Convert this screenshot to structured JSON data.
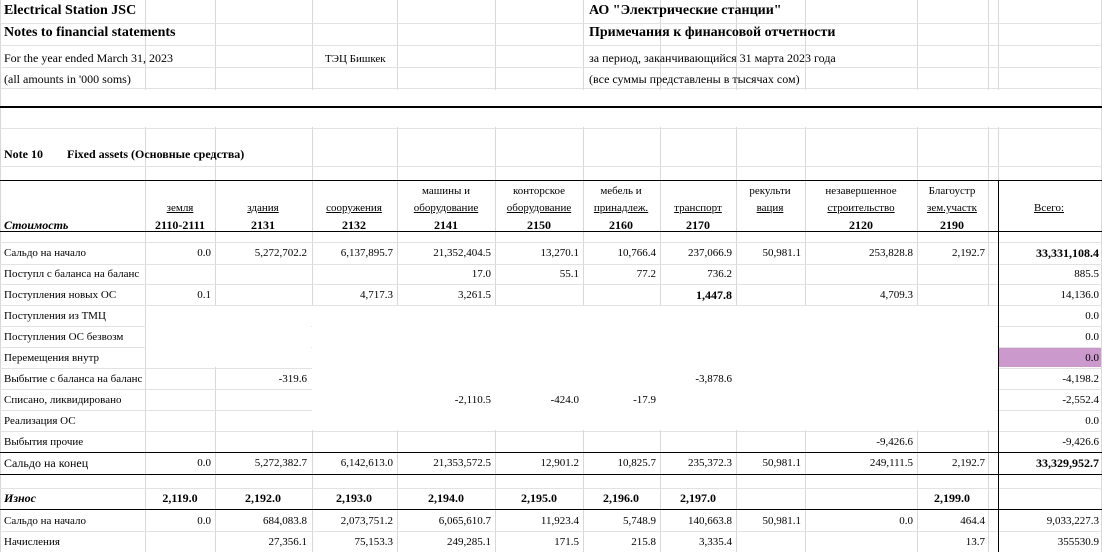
{
  "header": {
    "company_en": "Electrical Station JSC",
    "notes_en": "Notes to financial statements",
    "period_en": "For the year ended March 31, 2023",
    "amounts_en": "(all amounts in '000 soms)",
    "plant": "ТЭЦ Бишкек",
    "company_ru": "АО \"Электрические станции\"",
    "notes_ru": "Примечания к финансовой отчетности",
    "period_ru": "за период, заканчивающийся  31 марта 2023 года",
    "amounts_ru": "(все суммы представлены в тысячах сом)"
  },
  "note": {
    "number": "Note 10",
    "title": "Fixed assets (Основные средства)"
  },
  "columns": [
    {
      "line1": "",
      "line2": "земля",
      "code": "2110-2111"
    },
    {
      "line1": "",
      "line2": "здания",
      "code": "2131"
    },
    {
      "line1": "",
      "line2": "сооружения",
      "code": "2132"
    },
    {
      "line1": "машины и",
      "line2": "оборудование",
      "code": "2141"
    },
    {
      "line1": "конторское",
      "line2": "оборудование",
      "code": "2150"
    },
    {
      "line1": "мебель и",
      "line2": "принадлеж.",
      "code": "2160"
    },
    {
      "line1": "",
      "line2": "транспорт",
      "code": "2170"
    },
    {
      "line1": "рекульти",
      "line2": "вация",
      "code": ""
    },
    {
      "line1": "незавершенное",
      "line2": "строительство",
      "code": "2120"
    },
    {
      "line1": "Благоустр",
      "line2": "зем.участк",
      "code": "2190"
    },
    {
      "line1": "",
      "line2": "Всего:",
      "code": ""
    }
  ],
  "cost_label": "Стоимость",
  "cost_rows": [
    {
      "label": "Сальдо на начало",
      "values": [
        "0.0",
        "5,272,702.2",
        "6,137,895.7",
        "21,352,404.5",
        "13,270.1",
        "10,766.4",
        "237,066.9",
        "50,981.1",
        "253,828.8",
        "2,192.7",
        "33,331,108.4"
      ]
    },
    {
      "label": "Поступл с баланса на баланс",
      "values": [
        "",
        "",
        "",
        "17.0",
        "55.1",
        "77.2",
        "736.2",
        "",
        "",
        "",
        "885.5"
      ]
    },
    {
      "label": "Поступления новых ОС",
      "values": [
        "0.1",
        "",
        "4,717.3",
        "3,261.5",
        "",
        "",
        "1,447.8",
        "",
        "4,709.3",
        "",
        "14,136.0"
      ]
    },
    {
      "label": "Поступления из ТМЦ",
      "values": [
        "",
        "",
        "",
        "",
        "",
        "",
        "",
        "",
        "",
        "",
        "0.0"
      ]
    },
    {
      "label": "Поступления ОС безвозм",
      "values": [
        "",
        "",
        "",
        "",
        "",
        "",
        "",
        "",
        "",
        "",
        "0.0"
      ]
    },
    {
      "label": "Перемещения внутр",
      "values": [
        "",
        "",
        "",
        "",
        "",
        "",
        "",
        "",
        "",
        "",
        "0.0"
      ]
    },
    {
      "label": "Выбытие с баланса на баланс",
      "values": [
        "",
        "-319.6",
        "",
        "",
        "",
        "",
        "-3,878.6",
        "",
        "",
        "",
        "-4,198.2"
      ]
    },
    {
      "label": "Списано, ликвидировано",
      "values": [
        "",
        "",
        "",
        "-2,110.5",
        "-424.0",
        "-17.9",
        "",
        "",
        "",
        "",
        "-2,552.4"
      ]
    },
    {
      "label": "Реализация ОС",
      "values": [
        "",
        "",
        "",
        "",
        "",
        "",
        "",
        "",
        "",
        "",
        "0.0"
      ]
    },
    {
      "label": "Выбытия прочие",
      "values": [
        "",
        "",
        "",
        "",
        "",
        "",
        "",
        "",
        "-9,426.6",
        "",
        "-9,426.6"
      ]
    },
    {
      "label": "Сальдо на конец",
      "values": [
        "0.0",
        "5,272,382.7",
        "6,142,613.0",
        "21,353,572.5",
        "12,901.2",
        "10,825.7",
        "235,372.3",
        "50,981.1",
        "249,111.5",
        "2,192.7",
        "33,329,952.7"
      ]
    }
  ],
  "depr_label": "Износ",
  "depr_codes": [
    "2,119.0",
    "2,192.0",
    "2,193.0",
    "2,194.0",
    "2,195.0",
    "2,196.0",
    "2,197.0",
    "",
    "",
    "2,199.0",
    ""
  ],
  "depr_rows": [
    {
      "label": "Сальдо на начало",
      "values": [
        "0.0",
        "684,083.8",
        "2,073,751.2",
        "6,065,610.7",
        "11,923.4",
        "5,748.9",
        "140,663.8",
        "50,981.1",
        "0.0",
        "464.4",
        "9,033,227.3"
      ]
    },
    {
      "label": "Начисления",
      "values": [
        "",
        "27,356.1",
        "75,153.3",
        "249,285.1",
        "171.5",
        "215.8",
        "3,335.4",
        "",
        "",
        "13.7",
        "355530.9"
      ]
    }
  ],
  "highlight_color": "#cc99cc"
}
